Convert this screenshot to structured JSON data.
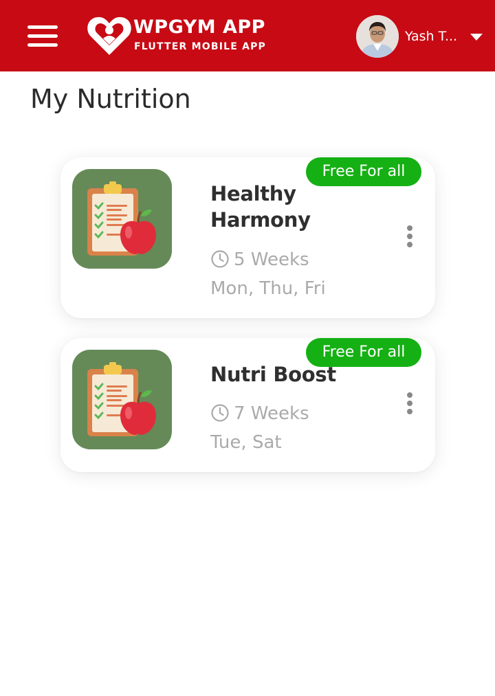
{
  "header": {
    "app_title": "WPGYM APP",
    "app_subtitle": "FLUTTER MOBILE APP",
    "user_name": "Yash T...",
    "menu_icon": "hamburger-menu-icon",
    "dropdown_icon": "caret-down-icon",
    "background_color": "#c70a14"
  },
  "page": {
    "title": "My Nutrition"
  },
  "plans": [
    {
      "badge": "Free For all",
      "name": "Healthy Harmony",
      "duration": "5 Weeks",
      "days": "Mon, Thu, Fri",
      "image_icon": "nutrition-clipboard-apple-icon"
    },
    {
      "badge": "Free For all",
      "name": "Nutri Boost",
      "duration": "7 Weeks",
      "days": "Tue, Sat",
      "image_icon": "nutrition-clipboard-apple-icon"
    }
  ],
  "colors": {
    "badge": "#15b014",
    "card_image_bg": "#658a58",
    "muted_text": "#aaaaaa"
  }
}
